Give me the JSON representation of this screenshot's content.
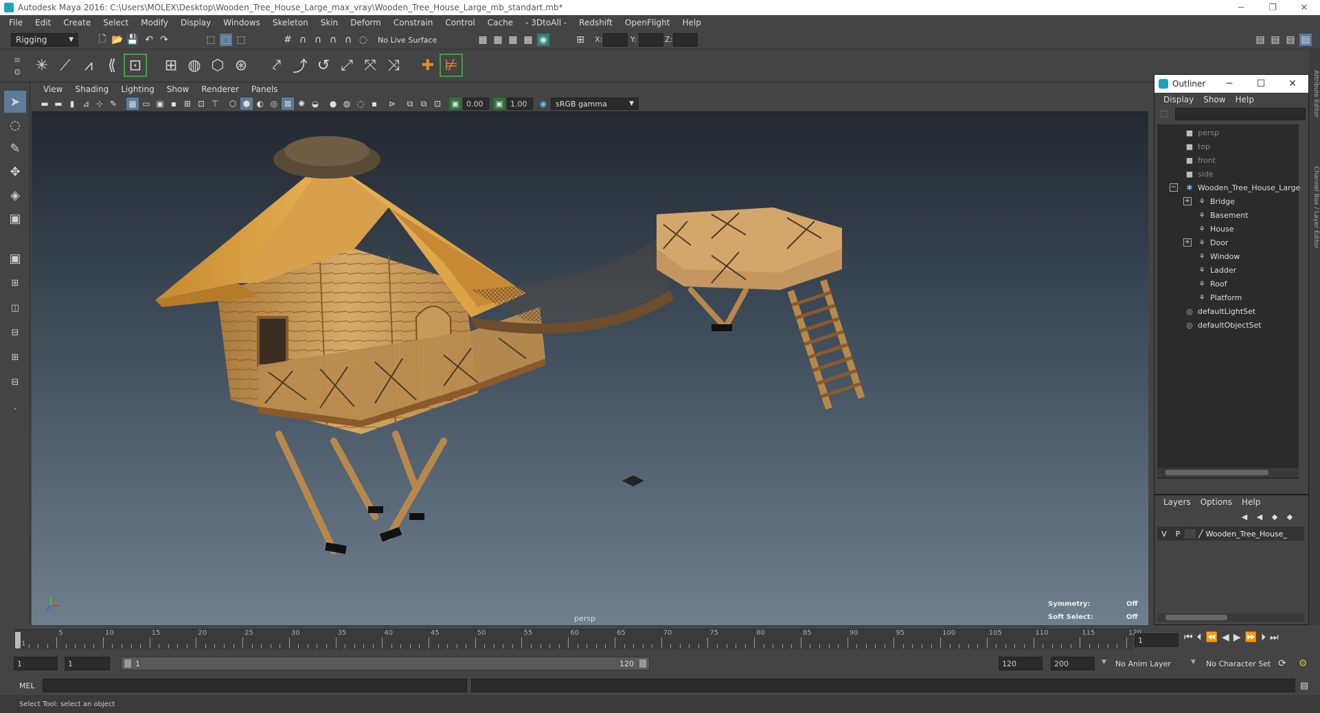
{
  "window": {
    "title": "Autodesk Maya 2016: C:\\Users\\MOLEX\\Desktop\\Wooden_Tree_House_Large_max_vray\\Wooden_Tree_House_Large_mb_standart.mb*",
    "minimize": "─",
    "restore": "❐",
    "close": "✕"
  },
  "menubar": [
    "File",
    "Edit",
    "Create",
    "Select",
    "Modify",
    "Display",
    "Windows",
    "Skeleton",
    "Skin",
    "Deform",
    "Constrain",
    "Control",
    "Cache",
    "- 3DtoAll -",
    "Redshift",
    "OpenFlight",
    "Help"
  ],
  "statusline": {
    "menuset": "Rigging",
    "live_surface": "No Live Surface",
    "x_label": "X:",
    "y_label": "Y:",
    "z_label": "Z:"
  },
  "viewport": {
    "menu": [
      "View",
      "Shading",
      "Lighting",
      "Show",
      "Renderer",
      "Panels"
    ],
    "exposure": "0.00",
    "gamma": "1.00",
    "colorspace": "sRGB gamma",
    "camera_label": "persp",
    "symmetry_label": "Symmetry:",
    "symmetry_value": "Off",
    "soft_select_label": "Soft Select:",
    "soft_select_value": "Off"
  },
  "outliner": {
    "title": "Outliner",
    "minimize": "─",
    "maximize": "☐",
    "close": "✕",
    "menu": [
      "Display",
      "Show",
      "Help"
    ],
    "items": [
      {
        "label": "persp",
        "icon": "camera-icon",
        "dim": true
      },
      {
        "label": "top",
        "icon": "camera-icon",
        "dim": true
      },
      {
        "label": "front",
        "icon": "camera-icon",
        "dim": true
      },
      {
        "label": "side",
        "icon": "camera-icon",
        "dim": true
      },
      {
        "label": "Wooden_Tree_House_Large",
        "icon": "group-icon",
        "dim": false
      },
      {
        "label": "Bridge",
        "icon": "transform-icon",
        "dim": false
      },
      {
        "label": "Basement",
        "icon": "transform-icon",
        "dim": false
      },
      {
        "label": "House",
        "icon": "transform-icon",
        "dim": false
      },
      {
        "label": "Door",
        "icon": "transform-icon",
        "dim": false
      },
      {
        "label": "Window",
        "icon": "transform-icon",
        "dim": false
      },
      {
        "label": "Ladder",
        "icon": "transform-icon",
        "dim": false
      },
      {
        "label": "Roof",
        "icon": "transform-icon",
        "dim": false
      },
      {
        "label": "Platform",
        "icon": "transform-icon",
        "dim": false
      },
      {
        "label": "defaultLightSet",
        "icon": "set-icon",
        "dim": false
      },
      {
        "label": "defaultObjectSet",
        "icon": "set-icon",
        "dim": false
      }
    ]
  },
  "layers": {
    "menu": [
      "Layers",
      "Options",
      "Help"
    ],
    "row": {
      "v": "V",
      "p": "P",
      "name": "Wooden_Tree_House_"
    }
  },
  "sidetabs": [
    "Attribute Editor",
    "Channel Box / Layer Editor"
  ],
  "timeslider": {
    "ticks": [
      "1",
      "5",
      "10",
      "15",
      "20",
      "25",
      "30",
      "35",
      "40",
      "45",
      "50",
      "55",
      "60",
      "65",
      "70",
      "75",
      "80",
      "85",
      "90",
      "95",
      "100",
      "105",
      "110",
      "115",
      "120"
    ],
    "current_frame": "1"
  },
  "rangeslider": {
    "start": "1",
    "inner_start": "1",
    "range_start": "1",
    "range_end": "120",
    "end": "120",
    "max": "200",
    "anim_layer": "No Anim Layer",
    "character_set": "No Character Set"
  },
  "cmdline": {
    "label": "MEL"
  },
  "helpline": {
    "text": "Select Tool: select an object"
  },
  "colors": {
    "accent": "#5d7c99",
    "maya_teal": "#1aa5b8",
    "wood": "#d9a452",
    "roof": "#e0a848"
  }
}
